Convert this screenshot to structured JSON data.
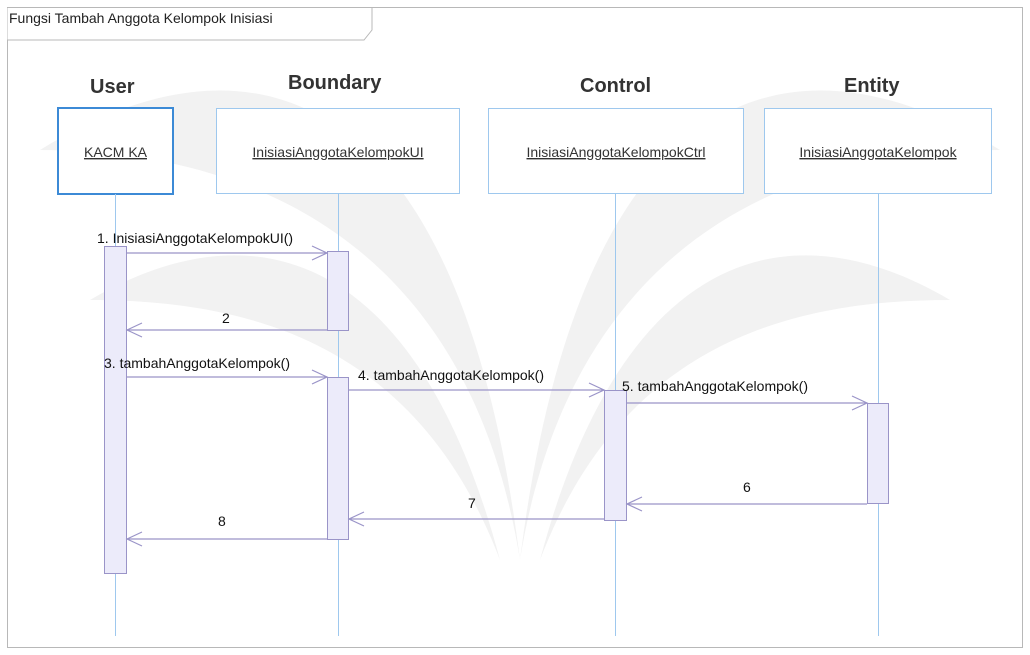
{
  "frame": {
    "title": "Fungsi Tambah Anggota Kelompok Inisiasi"
  },
  "headers": [
    "User",
    "Boundary",
    "Control",
    "Entity"
  ],
  "objects": [
    "KACM KA",
    "InisiasiAnggotaKelompokUI",
    "InisiasiAnggotaKelompokCtrl",
    "InisiasiAnggotaKelompok"
  ],
  "messages": [
    "1. InisiasiAnggotaKelompokUI()",
    "2",
    "3. tambahAnggotaKelompok()",
    "4. tambahAnggotaKelompok()",
    "5. tambahAnggotaKelompok()",
    "6",
    "7",
    "8"
  ],
  "colors": {
    "frame": "#b8b8b8",
    "actor_box": "#3c8ad6",
    "object_box": "#9ec8ee",
    "lifeline": "#9ec8ee",
    "activation_fill": "#ecebfa",
    "activation_stroke": "#9a94c8",
    "message_line": "#9a94c8",
    "watermark": "#f2f2f2"
  }
}
